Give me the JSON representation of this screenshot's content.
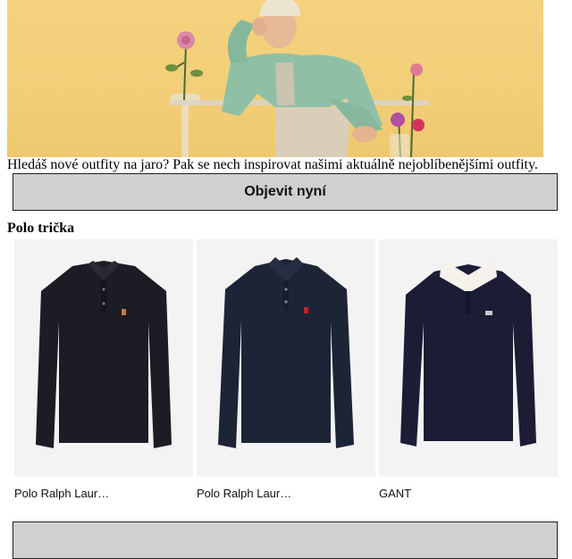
{
  "hero": {
    "alt": "Man in a mint green jacket and beige beanie seated among spring flowers"
  },
  "promo": {
    "text": "Hledáš nové outfity na jaro? Pak se nech inspirovat našimi aktuálně nejoblíbenějšími outfity."
  },
  "cta": {
    "label": "Objevit nyní"
  },
  "section": {
    "title": "Polo trička"
  },
  "products": [
    {
      "brand": "Polo Ralph Laur…",
      "color": "#1c1c24",
      "logo_color": "#c47a3a"
    },
    {
      "brand": "Polo Ralph Laur…",
      "color": "#1d2436",
      "logo_color": "#c0202a"
    },
    {
      "brand": "GANT",
      "color": "#1c1d35",
      "logo_color": "#f4f2ea"
    }
  ],
  "colors": {
    "hero_background": "#f2cf79",
    "button_background": "#d0d0d0"
  }
}
